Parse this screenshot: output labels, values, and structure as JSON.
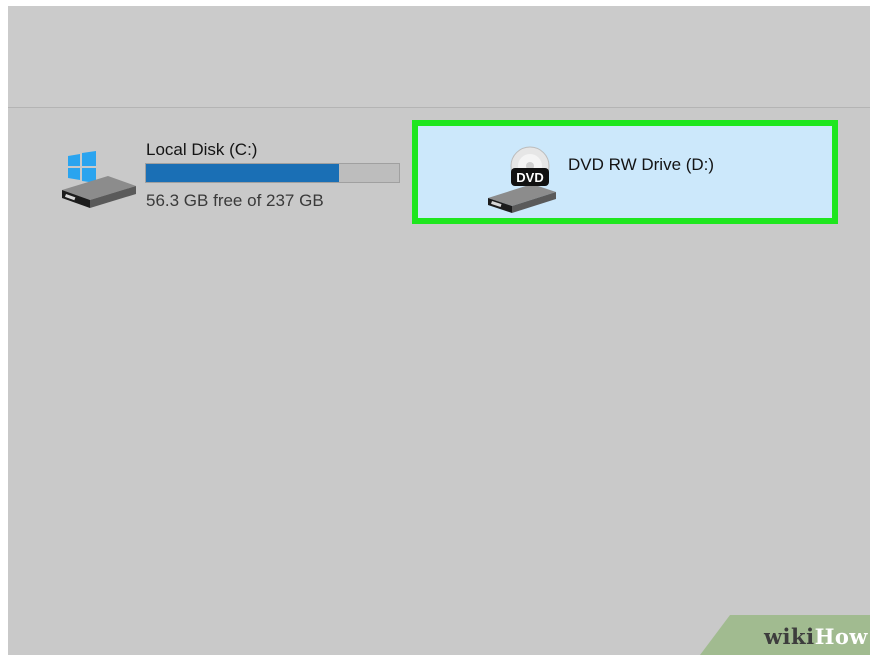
{
  "drives": {
    "local_disk": {
      "name": "Local Disk (C:)",
      "free_text": "56.3 GB free of 237 GB",
      "used_fraction": 0.762,
      "bar_color": "#1a6fb5",
      "icon": "windows-hard-drive-icon"
    },
    "dvd": {
      "name": "DVD RW Drive (D:)",
      "icon_label": "DVD",
      "icon": "dvd-drive-icon",
      "highlight_color": "#1ee61e",
      "selected_bg": "#cce8fb"
    }
  },
  "watermark": {
    "text_wiki": "wiki",
    "text_how": "How"
  }
}
